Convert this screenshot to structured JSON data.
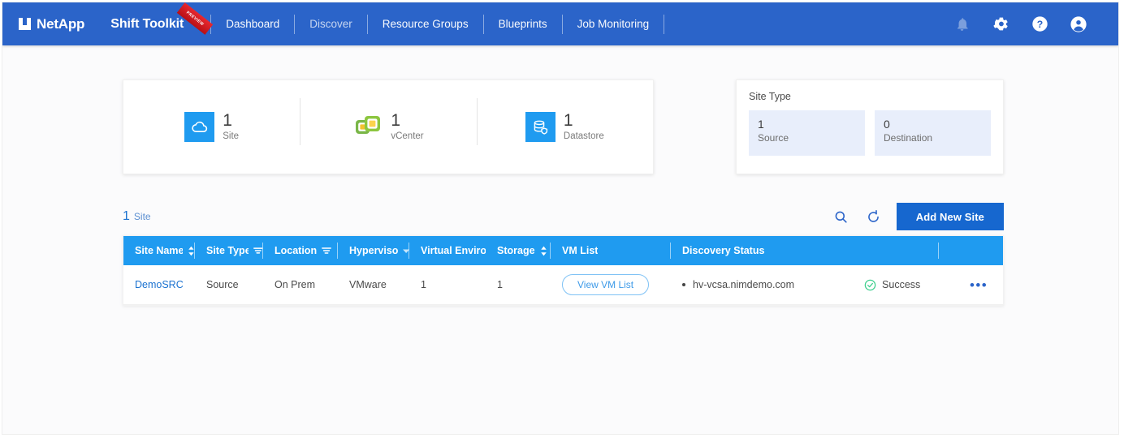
{
  "brand": {
    "logo_text": "NetApp",
    "product": "Shift Toolkit",
    "ribbon": "PREVIEW"
  },
  "nav": {
    "items": [
      {
        "label": "Dashboard",
        "active": true
      },
      {
        "label": "Discover",
        "active": false
      },
      {
        "label": "Resource Groups",
        "active": true
      },
      {
        "label": "Blueprints",
        "active": true
      },
      {
        "label": "Job Monitoring",
        "active": true
      }
    ],
    "icons": [
      {
        "name": "bell-icon",
        "title": "Notifications"
      },
      {
        "name": "gear-icon",
        "title": "Settings"
      },
      {
        "name": "help-icon",
        "title": "Help"
      },
      {
        "name": "account-icon",
        "title": "Account"
      }
    ]
  },
  "kpis": [
    {
      "icon": "cloud-icon",
      "value": "1",
      "label": "Site"
    },
    {
      "icon": "vcenter-icon",
      "value": "1",
      "label": "vCenter"
    },
    {
      "icon": "datastore-icon",
      "value": "1",
      "label": "Datastore"
    }
  ],
  "site_type_card": {
    "title": "Site Type",
    "tiles": [
      {
        "value": "1",
        "label": "Source"
      },
      {
        "value": "0",
        "label": "Destination"
      }
    ]
  },
  "toolbar": {
    "count": "1",
    "count_label": "Site",
    "search_icon": "search-icon",
    "refresh_icon": "refresh-icon",
    "add_button": "Add New Site"
  },
  "table": {
    "columns": [
      {
        "label": "Site Name",
        "control": "sort"
      },
      {
        "label": "Site Type",
        "control": "filter"
      },
      {
        "label": "Location",
        "control": "filter"
      },
      {
        "label": "Hypervisor",
        "control": "caret"
      },
      {
        "label": "Virtual Environ",
        "control": "none"
      },
      {
        "label": "Storage",
        "control": "sort"
      },
      {
        "label": "VM List",
        "control": "none"
      },
      {
        "label": "Discovery Status",
        "control": "none"
      },
      {
        "label": "",
        "control": "none"
      }
    ],
    "rows": [
      {
        "site_name": "DemoSRC",
        "site_type": "Source",
        "location": "On Prem",
        "hypervisor": "VMware",
        "virtual_environment": "1",
        "storage": "1",
        "vm_list_button": "View VM List",
        "discovery_host": "hv-vcsa.nimdemo.com",
        "status": "Success",
        "actions": "•••"
      }
    ]
  },
  "colors": {
    "navbar_blue": "#2b64c9",
    "table_header_blue": "#1f9bf0",
    "primary_button_blue": "#1667cf",
    "link_blue": "#1b72d0",
    "success_green": "#3ecf8e",
    "tile_blue": "#e8eefb",
    "page_background": "#fbfbfc"
  }
}
